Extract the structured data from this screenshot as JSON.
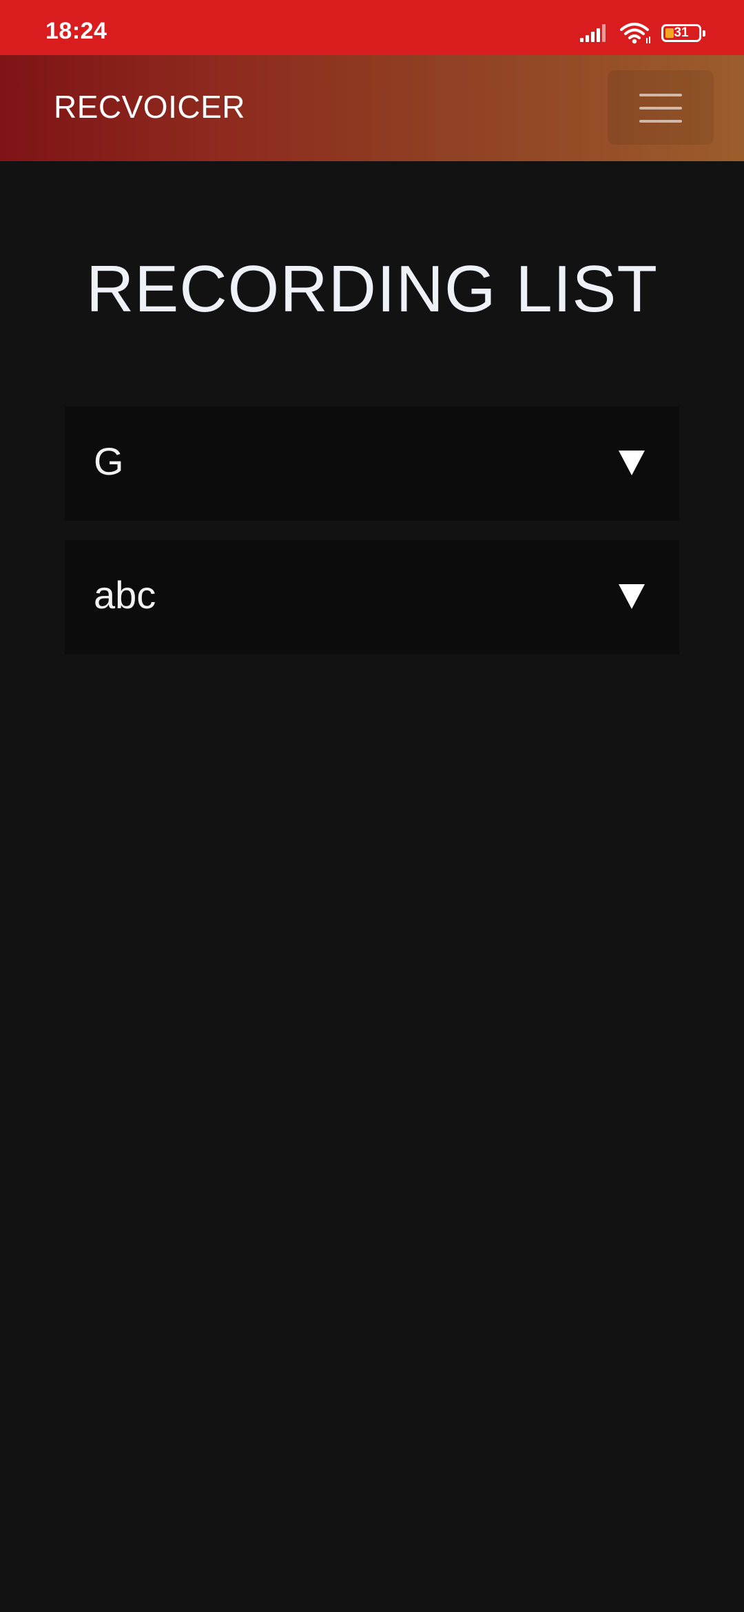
{
  "status_bar": {
    "time": "18:24",
    "battery_level": "31",
    "icons": [
      "signal-icon",
      "wifi-icon",
      "battery-icon"
    ]
  },
  "header": {
    "app_title": "RECVOICER",
    "menu_icon": "hamburger-menu-icon"
  },
  "main": {
    "title": "RECORDING LIST",
    "recordings": [
      {
        "name": "G",
        "expand_icon": "triangle-down-icon"
      },
      {
        "name": "abc",
        "expand_icon": "triangle-down-icon"
      }
    ]
  },
  "colors": {
    "status_bar": "#d91c1e",
    "header_gradient_start": "#7e1416",
    "header_gradient_end": "#9c5d2c",
    "background": "#121212",
    "item_background": "#0c0c0c",
    "battery_fill": "#f5a623"
  }
}
